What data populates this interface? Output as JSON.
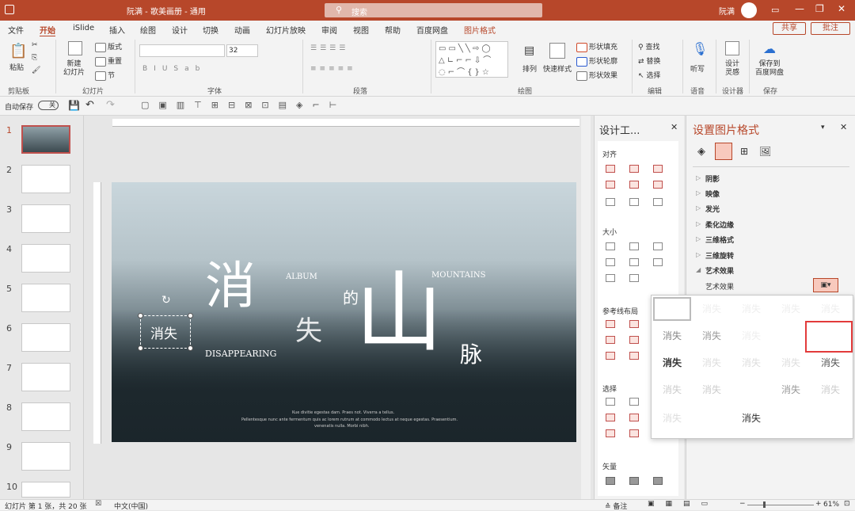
{
  "window": {
    "title": "阮满 - 歌美画册 - 通用",
    "search_placeholder": "搜索",
    "user": "阮满"
  },
  "tabs": [
    "文件",
    "开始",
    "iSlide",
    "插入",
    "绘图",
    "设计",
    "切换",
    "动画",
    "幻灯片放映",
    "审阅",
    "视图",
    "帮助",
    "百度网盘",
    "图片格式"
  ],
  "active_tab": "开始",
  "context_tab": "图片格式",
  "actions": {
    "share": "共享",
    "comment": "批注"
  },
  "ribbon": {
    "groups": [
      "剪贴板",
      "幻灯片",
      "字体",
      "段落",
      "绘图",
      "编辑",
      "语音",
      "设计器",
      "保存"
    ],
    "paste": "粘贴",
    "new_slide": "新建\n幻灯片",
    "layout": "版式",
    "reset": "重置",
    "section": "节",
    "font_size": "32",
    "arrange": "排列",
    "quick_styles": "快速样式",
    "shape_fill": "形状填充",
    "shape_outline": "形状轮廓",
    "shape_effects": "形状效果",
    "find": "查找",
    "replace": "替换",
    "select": "选择",
    "dictate": "听写",
    "designer": "设计\n灵感",
    "save_baidu": "保存到\n百度网盘"
  },
  "qat": {
    "autosave": "自动保存",
    "autosave_state": "关"
  },
  "thumbnails": [
    1,
    2,
    3,
    4,
    5,
    6,
    7,
    8,
    9,
    10
  ],
  "slide": {
    "big_char_1": "消",
    "big_char_2": "失",
    "small_char": "的",
    "mountain": "山",
    "vein": "脉",
    "album": "ALBUM",
    "mountains": "MOUNTAINS",
    "disappearing": "DISAPPEARING",
    "selected_box": "消失",
    "caption_1": "Kue divitie egestas dam. Praes not. Viverra a tellus.",
    "caption_2": "Pellentesque nunc ante fermentum quis ac lorem rutrum at commodo lectus at neque egestas. Praesentium.",
    "caption_3": "venenatis nulla. Morbi nibh."
  },
  "design_pane": {
    "title": "设计工...",
    "sections": [
      "对齐",
      "大小",
      "参考线布局",
      "选择",
      "矢量"
    ]
  },
  "format_pane": {
    "title": "设置图片格式",
    "items": [
      "阴影",
      "映像",
      "发光",
      "柔化边缘",
      "三维格式",
      "三维旋转",
      "艺术效果"
    ],
    "art_effect_label": "艺术效果"
  },
  "gallery": {
    "cells": [
      "消失",
      "消失",
      "消失",
      "消失",
      "消失",
      "消失",
      "消失",
      "消失",
      "消失",
      "消失",
      "消失",
      "消失",
      "消失",
      "消失",
      "消失",
      "消失",
      "消失",
      "消失"
    ]
  },
  "status": {
    "slide_info": "幻灯片 第 1 张，共 20 张",
    "language": "中文(中国)",
    "notes": "备注",
    "zoom": "61%"
  },
  "colors": {
    "accent": "#b7472a",
    "highlight": "#e23b3b"
  }
}
